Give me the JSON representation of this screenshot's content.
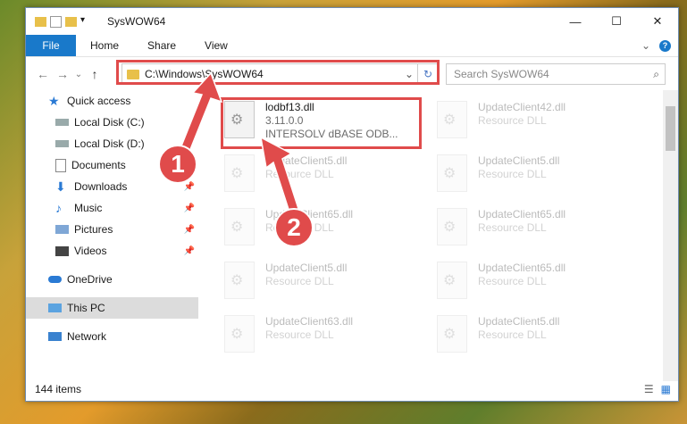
{
  "window": {
    "title": "SysWOW64",
    "minimize": "—",
    "maximize": "☐",
    "close": "✕"
  },
  "ribbon": {
    "file_tab": "File",
    "tabs": [
      "Home",
      "Share",
      "View"
    ],
    "help": "?"
  },
  "nav": {
    "back": "←",
    "forward": "→",
    "dropdown": "⌄",
    "up": "↑",
    "address": "C:\\Windows\\SysWOW64",
    "address_chevron": "⌄",
    "refresh": "↻",
    "search_placeholder": "Search SysWOW64",
    "search_icon": "⌕"
  },
  "sidebar": {
    "items": [
      {
        "label": "Quick access",
        "icon": "star-icon",
        "pinned": false
      },
      {
        "label": "Local Disk (C:)",
        "icon": "drive-icon",
        "pinned": false
      },
      {
        "label": "Local Disk (D:)",
        "icon": "drive-icon",
        "pinned": false
      },
      {
        "label": "Documents",
        "icon": "documents-icon",
        "pinned": true
      },
      {
        "label": "Downloads",
        "icon": "downloads-icon",
        "pinned": true
      },
      {
        "label": "Music",
        "icon": "music-icon",
        "pinned": true
      },
      {
        "label": "Pictures",
        "icon": "pictures-icon",
        "pinned": true
      },
      {
        "label": "Videos",
        "icon": "videos-icon",
        "pinned": true
      },
      {
        "label": "OneDrive",
        "icon": "onedrive-icon",
        "pinned": false
      },
      {
        "label": "This PC",
        "icon": "pc-icon",
        "pinned": false
      },
      {
        "label": "Network",
        "icon": "network-icon",
        "pinned": false
      }
    ]
  },
  "files": [
    {
      "name": "lodbf13.dll",
      "line2": "3.11.0.0",
      "line3": "INTERSOLV dBASE ODB..."
    },
    {
      "name": "UpdateClient42.dll",
      "line2": "Resource DLL"
    },
    {
      "name": "UpdateClient5.dll",
      "line2": "Resource DLL"
    },
    {
      "name": "UpdateClient5.dll",
      "line2": "Resource DLL"
    },
    {
      "name": "UpdateClient65.dll",
      "line2": "Resource DLL"
    },
    {
      "name": "UpdateClient65.dll",
      "line2": "Resource DLL"
    },
    {
      "name": "UpdateClient5.dll",
      "line2": "Resource DLL"
    },
    {
      "name": "UpdateClient65.dll",
      "line2": "Resource DLL"
    },
    {
      "name": "UpdateClient63.dll",
      "line2": "Resource DLL"
    },
    {
      "name": "UpdateClient5.dll",
      "line2": "Resource DLL"
    }
  ],
  "status": {
    "count": "144 items"
  },
  "annotations": {
    "step1": "1",
    "step2": "2"
  },
  "colors": {
    "accent": "#1979ca",
    "highlight_red": "#e04b4b"
  }
}
